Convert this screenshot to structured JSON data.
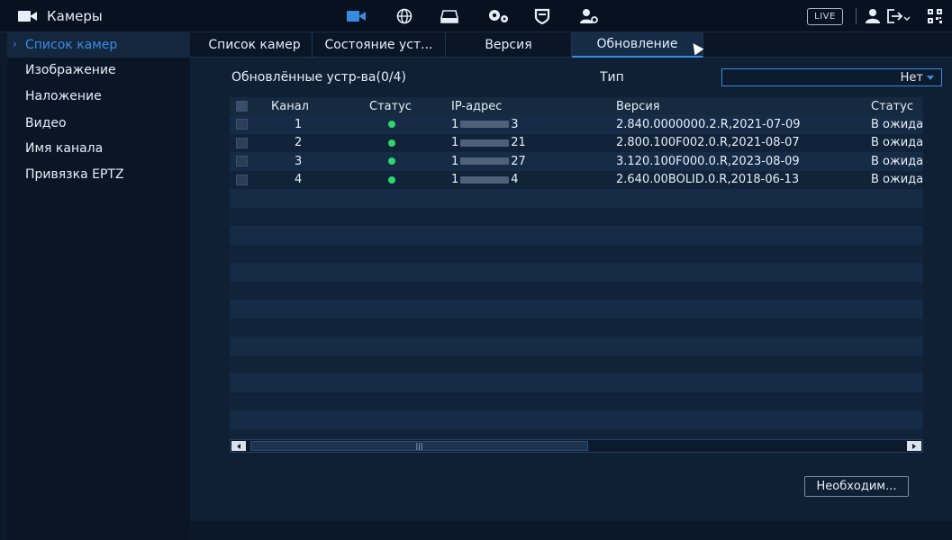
{
  "app": {
    "title": "Камеры",
    "top_icons": [
      "camera-icon",
      "globe-icon",
      "storage-icon",
      "settings-gears-icon",
      "shield-icon",
      "user-settings-icon"
    ],
    "live_label": "LIVE",
    "right_icons": [
      "user-icon",
      "logout-icon",
      "qr-code-icon"
    ],
    "accent_color": "#3a8be0"
  },
  "sidebar": {
    "items": [
      {
        "label": "Список камер",
        "active": true
      },
      {
        "label": "Изображение",
        "active": false
      },
      {
        "label": "Наложение",
        "active": false
      },
      {
        "label": "Видео",
        "active": false
      },
      {
        "label": "Имя канала",
        "active": false
      },
      {
        "label": "Привязка EPTZ",
        "active": false
      }
    ]
  },
  "tabs": [
    {
      "label": "Список камер",
      "active": false
    },
    {
      "label": "Состояние уст...",
      "active": false
    },
    {
      "label": "Версия",
      "active": false
    },
    {
      "label": "Обновление",
      "active": true
    }
  ],
  "main": {
    "updated_label": "Обновлённые устр-ва(0/4)",
    "type_label": "Тип",
    "type_value": "Нет",
    "table": {
      "columns": [
        "Канал",
        "Статус",
        "IP-адрес",
        "Версия",
        "Статус"
      ],
      "rows": [
        {
          "channel": "1",
          "status": "online",
          "ip_prefix": "1",
          "ip_suffix": "3",
          "version": "2.840.0000000.2.R,2021-07-09",
          "state": "В ожидан"
        },
        {
          "channel": "2",
          "status": "online",
          "ip_prefix": "1",
          "ip_suffix": "21",
          "version": "2.800.100F002.0.R,2021-08-07",
          "state": "В ожидан"
        },
        {
          "channel": "3",
          "status": "online",
          "ip_prefix": "1",
          "ip_suffix": "27",
          "version": "3.120.100F000.0.R,2023-08-09",
          "state": "В ожидан"
        },
        {
          "channel": "4",
          "status": "online",
          "ip_prefix": "1",
          "ip_suffix": "4",
          "version": "2.640.00BOLID.0.R,2018-06-13",
          "state": "В ожидан"
        }
      ],
      "status_color": "#2ed66e"
    },
    "scroll_thumb_label": "|||",
    "need_button": "Необходим..."
  }
}
